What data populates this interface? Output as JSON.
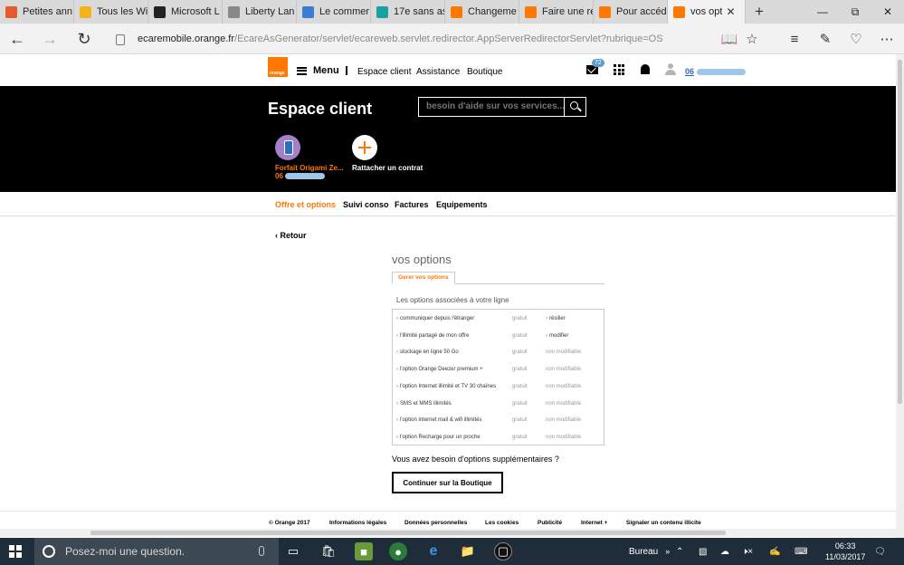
{
  "browser": {
    "tabs": [
      {
        "label": "Petites ann",
        "favicon_color": "#e25b2c",
        "active": false
      },
      {
        "label": "Tous les Wi",
        "favicon_color": "#f3b31b",
        "active": false
      },
      {
        "label": "Microsoft L",
        "favicon_color": "#222222",
        "active": false
      },
      {
        "label": "Liberty Lan",
        "favicon_color": "#888888",
        "active": false
      },
      {
        "label": "Le commer",
        "favicon_color": "#3a7bd5",
        "active": false
      },
      {
        "label": "17e sans as",
        "favicon_color": "#18a0a5",
        "active": false
      },
      {
        "label": "Changeme",
        "favicon_color": "#ff7900",
        "active": false
      },
      {
        "label": "Faire une re",
        "favicon_color": "#ff7900",
        "active": false
      },
      {
        "label": "Pour accéd",
        "favicon_color": "#ff7900",
        "active": false
      },
      {
        "label": "vos opt",
        "favicon_color": "#ff7900",
        "active": true
      }
    ],
    "url_host": "ecaremobile.orange.fr",
    "url_path": "/EcareAsGenerator/servlet/ecareweb.servlet.redirector.AppServerRedirectorServlet?rubrique=OS"
  },
  "topnav": {
    "logo_text": "orange",
    "menu_label": "Menu",
    "links": [
      "Espace client",
      "Assistance",
      "Boutique"
    ],
    "mail_badge": "72",
    "account_prefix": "06"
  },
  "hero": {
    "title": "Espace client",
    "search_placeholder": "besoin d'aide sur vos services...",
    "contract_name": "Forfait Origami Ze...",
    "contract_number_prefix": "06",
    "add_contract_label": "Rattacher un contrat"
  },
  "subnav": {
    "items": [
      "Offre et options",
      "Suivi conso",
      "Factures",
      "Equipements"
    ],
    "active_index": 0
  },
  "content": {
    "back_label": "Retour",
    "title": "vos options",
    "tab_label": "Gerer vos options",
    "subtitle": "Les options associées à votre ligne",
    "options": [
      {
        "name": "communiquer depuis l'étranger",
        "price": "gratuit",
        "action": "résilier",
        "action_is_link": true
      },
      {
        "name": "l'illimité partagé de mon offre",
        "price": "gratuit",
        "action": "modifier",
        "action_is_link": true
      },
      {
        "name": "stockage en ligne 50 Go",
        "price": "gratuit",
        "action": "non modifiable",
        "action_is_link": false
      },
      {
        "name": "l'option Orange Deezer premium +",
        "price": "gratuit",
        "action": "non modifiable",
        "action_is_link": false
      },
      {
        "name": "l'option Internet illimité et TV 30 chaînes",
        "price": "gratuit",
        "action": "non modifiable",
        "action_is_link": false
      },
      {
        "name": "SMS et MMS illimités",
        "price": "gratuit",
        "action": "non modifiable",
        "action_is_link": false
      },
      {
        "name": "l'option internet mail & wifi illimités",
        "price": "gratuit",
        "action": "non modifiable",
        "action_is_link": false
      },
      {
        "name": "l'option Recharge pour un proche",
        "price": "gratuit",
        "action": "non modifiable",
        "action_is_link": false
      }
    ],
    "need_more": "Vous avez besoin d'options supplémentaires ?",
    "shop_button": "Continuer sur la Boutique"
  },
  "footer": {
    "items": [
      "© Orange 2017",
      "Informations légales",
      "Données personnelles",
      "Les cookies",
      "Publicité",
      "Internet +",
      "Signaler un contenu illicite"
    ]
  },
  "taskbar": {
    "search_placeholder": "Posez-moi une question.",
    "desktop_label": "Bureau",
    "time": "06:33",
    "date": "11/03/2017"
  },
  "colors": {
    "brand_orange": "#ff7900",
    "hero_bg": "#000000",
    "link_blue": "#2f6ab1",
    "taskbar": "#1f2d3a"
  }
}
